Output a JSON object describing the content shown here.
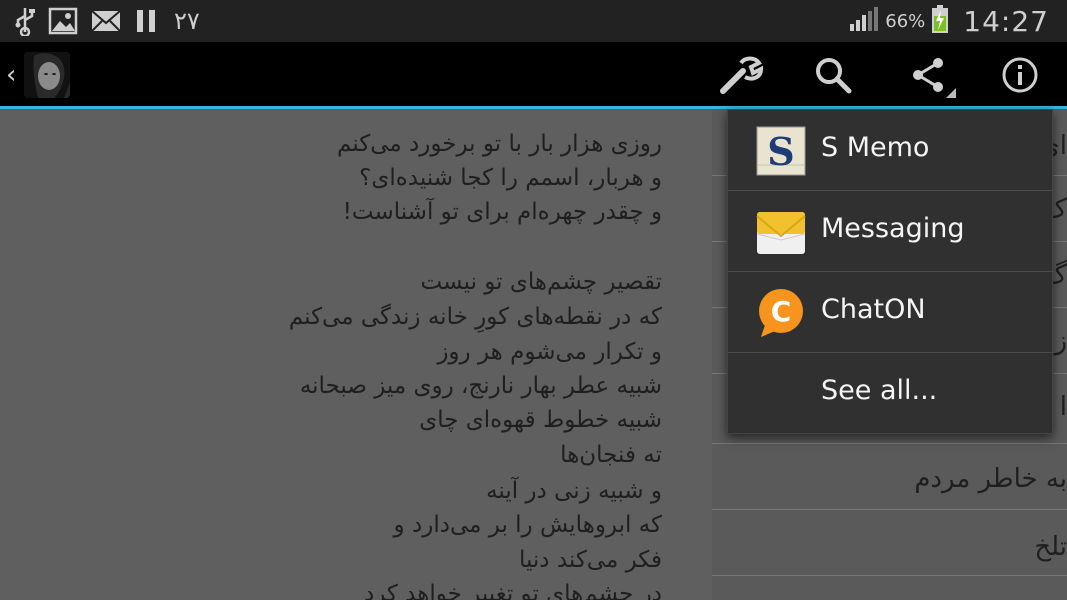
{
  "status_bar": {
    "notification_count": "۲۷",
    "battery_percent": "66%",
    "time": "14:27"
  },
  "action_bar": {
    "up_caret": "‹",
    "actions": [
      "settings-wrench",
      "search",
      "share",
      "info"
    ]
  },
  "poem": {
    "lines": [
      "روزی هزار بار با تو برخورد می‌کنم",
      "و هربار، اسمم را کجا شنیده‌ای؟",
      "و چقدر چهره‌ام برای تو آشناست!",
      "تقصیر چشم‌های تو نیست",
      "که در نقطه‌های کورِ خانه زندگی می‌کنم",
      "و تکرار می‌شوم هر روز",
      "شبیه عطر بهار نارنج، روی میز صبحانه",
      "شبیه خطوط قهوه‌ای چای",
      "ته فنجان‌ها",
      "و شبیه زنی در آینه",
      "که ابروهایش را بر می‌دارد و",
      "فکر می‌کند دنیا",
      "در چشم‌های تو تغییر خواهد کرد"
    ]
  },
  "side_list": {
    "items": [
      "ای",
      "ک",
      "گ",
      "ز",
      "ا",
      "به خاطر مردم",
      "تلخ"
    ]
  },
  "share_popup": {
    "items": [
      {
        "label": "S Memo",
        "icon": "s-memo-icon"
      },
      {
        "label": "Messaging",
        "icon": "messaging-icon"
      },
      {
        "label": "ChatON",
        "icon": "chaton-icon"
      },
      {
        "label": "See all...",
        "icon": ""
      }
    ]
  },
  "colors": {
    "accent": "#33b5e5",
    "chaton_orange": "#f7941d",
    "background": "#5f5f5f"
  }
}
